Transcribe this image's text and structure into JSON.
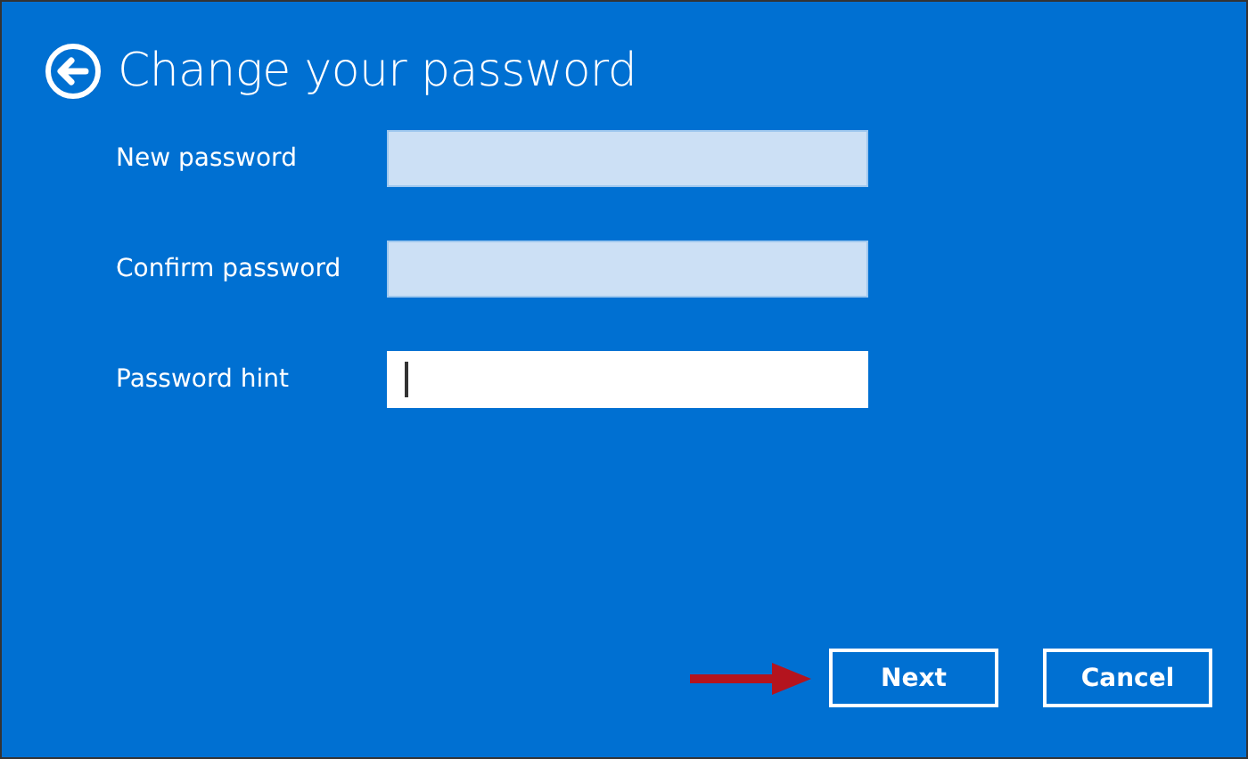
{
  "title": "Change your password",
  "fields": [
    {
      "label": "New password",
      "focused": false
    },
    {
      "label": "Confirm password",
      "focused": false
    },
    {
      "label": "Password hint",
      "focused": true
    }
  ],
  "buttons": [
    {
      "label": "Next"
    },
    {
      "label": "Cancel"
    }
  ]
}
